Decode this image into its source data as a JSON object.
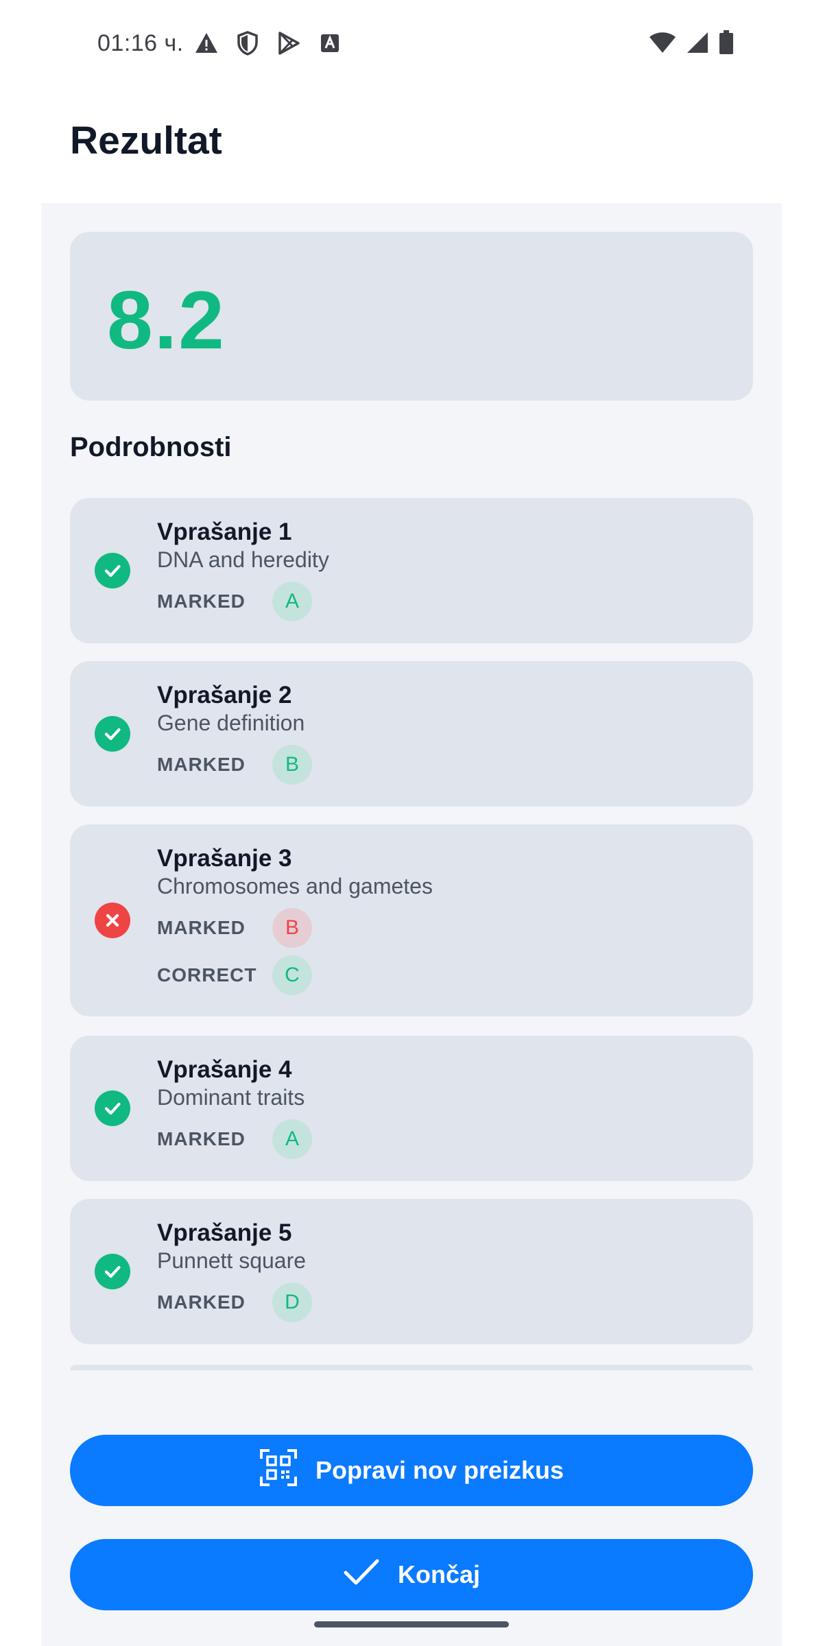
{
  "status_bar": {
    "time": "01:16 ч.",
    "left_icons": [
      "warning-icon",
      "shield-icon",
      "play-store-icon",
      "text-box-icon"
    ],
    "right_icons": [
      "wifi-icon",
      "cell-signal-icon",
      "battery-icon"
    ]
  },
  "header": {
    "title": "Rezultat"
  },
  "score": {
    "value": "8.2",
    "color": "#10b981"
  },
  "details": {
    "heading": "Podrobnosti",
    "questions": [
      {
        "title": "Vprašanje 1",
        "topic": "DNA and heredity",
        "status": "correct",
        "marked_label": "MARKED",
        "marked": "A"
      },
      {
        "title": "Vprašanje 2",
        "topic": "Gene definition",
        "status": "correct",
        "marked_label": "MARKED",
        "marked": "B"
      },
      {
        "title": "Vprašanje 3",
        "topic": "Chromosomes and gametes",
        "status": "incorrect",
        "marked_label": "MARKED",
        "marked": "B",
        "correct_label": "CORRECT",
        "correct": "C"
      },
      {
        "title": "Vprašanje 4",
        "topic": "Dominant traits",
        "status": "correct",
        "marked_label": "MARKED",
        "marked": "A"
      },
      {
        "title": "Vprašanje 5",
        "topic": "Punnett square",
        "status": "correct",
        "marked_label": "MARKED",
        "marked": "D"
      }
    ]
  },
  "actions": {
    "scan_label": "Popravi nov preizkus",
    "scan_icon": "qr-scan-icon",
    "finish_label": "Končaj",
    "finish_icon": "check-icon",
    "accent_color": "#0a7aff"
  },
  "colors": {
    "correct": "#10b981",
    "incorrect": "#ef4444"
  }
}
